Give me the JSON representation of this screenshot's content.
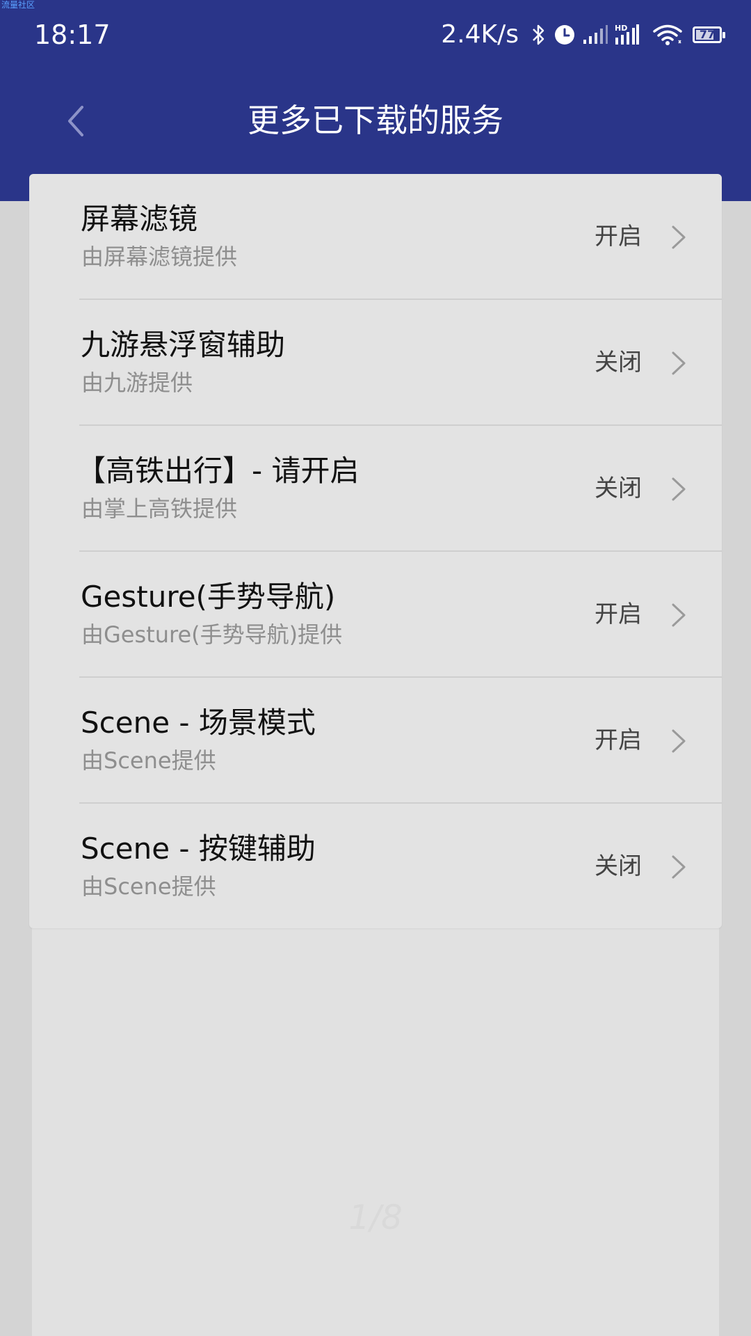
{
  "watermark": "流量社区",
  "status_bar": {
    "time": "18:17",
    "net_speed": "2.4K/s",
    "battery_level": "77",
    "battery_fraction": 0.77,
    "icons": [
      "bluetooth-icon",
      "alarm-icon",
      "cell-signal-icon",
      "hd-signal-icon",
      "wifi-icon",
      "battery-icon"
    ]
  },
  "header": {
    "title": "更多已下载的服务",
    "back_icon": "chevron-left-icon"
  },
  "services": [
    {
      "title": "屏幕滤镜",
      "subtitle": "由屏幕滤镜提供",
      "status": "开启"
    },
    {
      "title": "九游悬浮窗辅助",
      "subtitle": "由九游提供",
      "status": "关闭"
    },
    {
      "title": "【高铁出行】- 请开启",
      "subtitle": "由掌上高铁提供",
      "status": "关闭"
    },
    {
      "title": "Gesture(手势导航)",
      "subtitle": "由Gesture(手势导航)提供",
      "status": "开启"
    },
    {
      "title": "Scene - 场景模式",
      "subtitle": "由Scene提供",
      "status": "开启"
    },
    {
      "title": "Scene - 按键辅助",
      "subtitle": "由Scene提供",
      "status": "关闭"
    }
  ],
  "page_indicator": "1/8",
  "colors": {
    "header_bg": "#2a3589",
    "page_bg": "#d4d4d4",
    "card_bg": "#e3e3e3"
  }
}
